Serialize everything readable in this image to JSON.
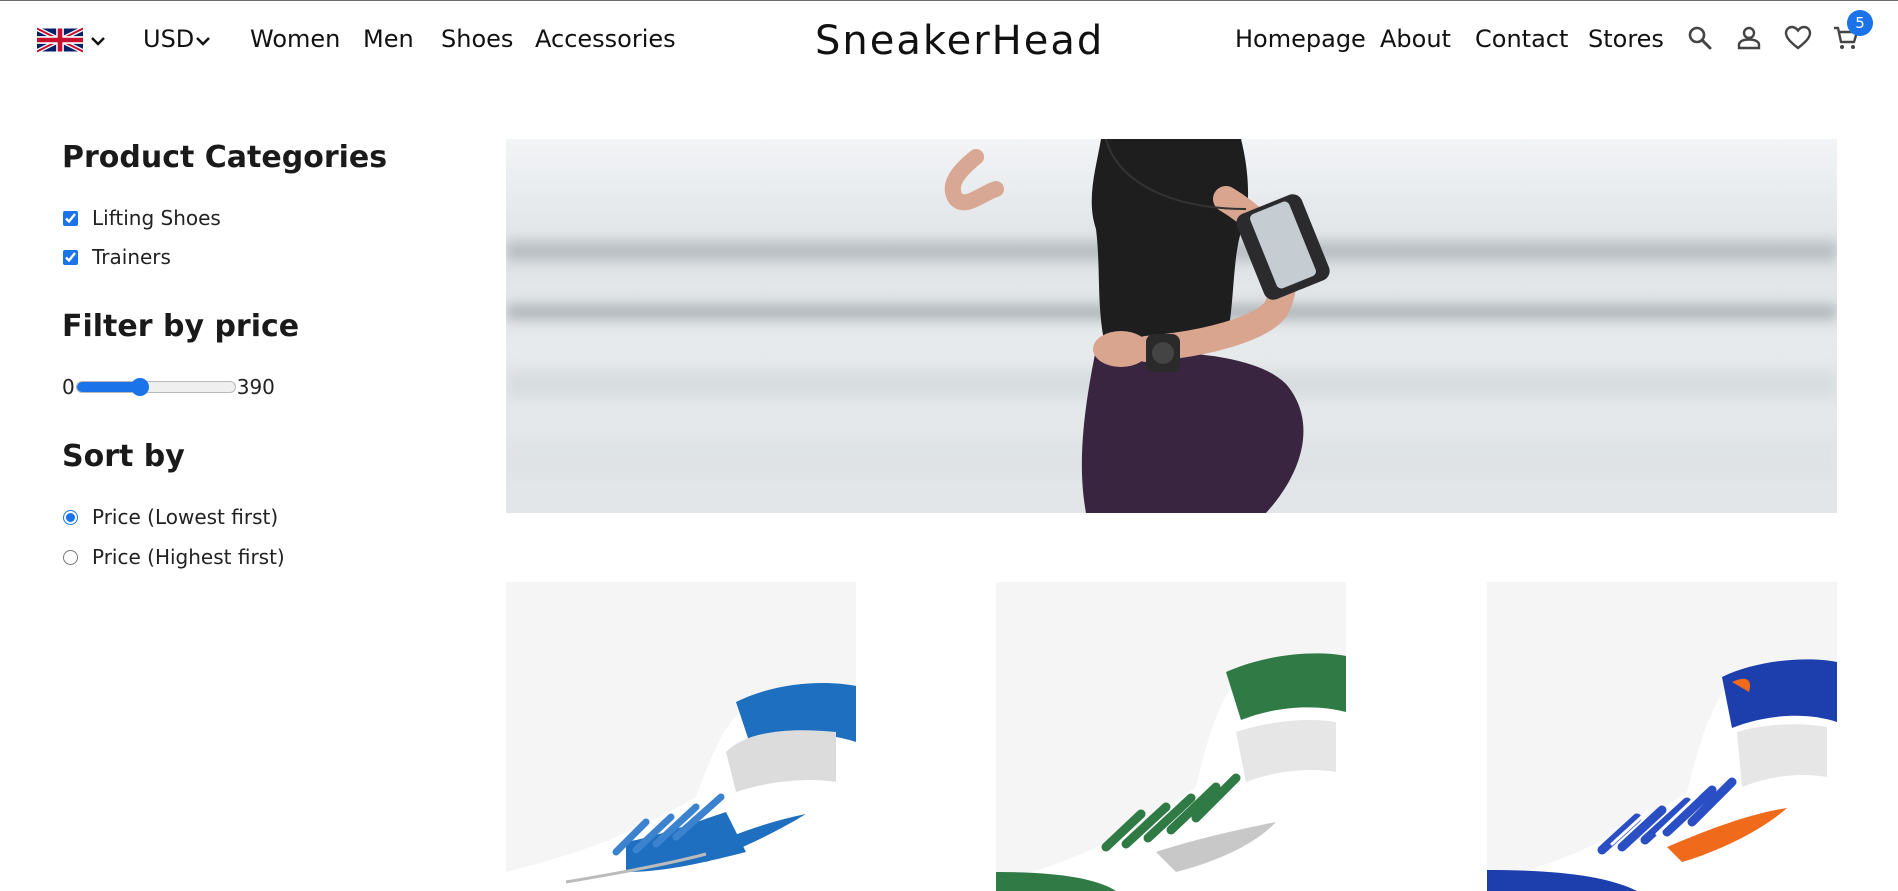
{
  "header": {
    "brand": "SneakerHead",
    "currency": "USD",
    "nav_left": [
      "Women",
      "Men",
      "Shoes",
      "Accessories"
    ],
    "nav_right": [
      "Homepage",
      "About",
      "Contact",
      "Stores"
    ],
    "cart_count": "5",
    "icons": [
      "uk-flag-icon",
      "chevron-down-icon",
      "search-icon",
      "user-icon",
      "heart-icon",
      "cart-icon"
    ],
    "accent_color": "#1a73e8"
  },
  "sidebar": {
    "categories_title": "Product Categories",
    "categories": [
      {
        "label": "Lifting Shoes",
        "checked": true
      },
      {
        "label": "Trainers",
        "checked": true
      }
    ],
    "price_title": "Filter by price",
    "price_min": "0",
    "price_max": "390",
    "price_slider_fraction": 0.4,
    "sort_title": "Sort by",
    "sort_options": [
      {
        "label": "Price (Lowest first)",
        "selected": true
      },
      {
        "label": "Price (Highest first)",
        "selected": false
      }
    ]
  },
  "products": [
    {
      "colorway": "blue",
      "primary": "#1f6fc0",
      "accent": "#1f6fc0"
    },
    {
      "colorway": "green",
      "primary": "#2f7a45",
      "accent": "#bdbdbd"
    },
    {
      "colorway": "royal-blue",
      "primary": "#1d3fae",
      "accent": "#ef6a1a"
    }
  ]
}
